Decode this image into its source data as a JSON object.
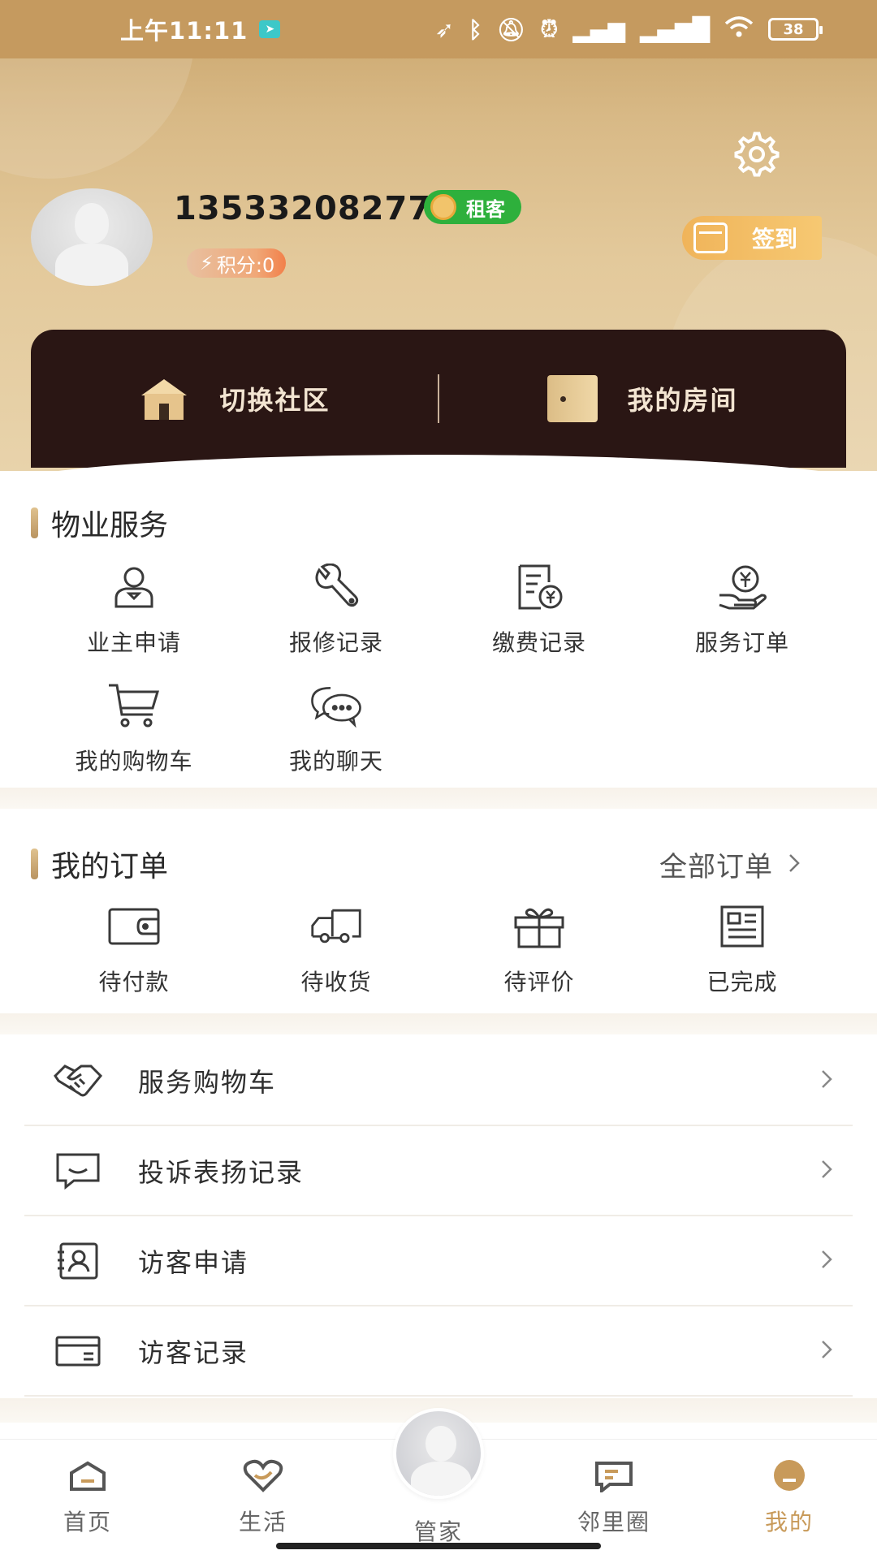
{
  "status_bar": {
    "time": "上午11:11",
    "battery": "38",
    "icons": [
      "location-icon",
      "bluetooth-icon",
      "mute-icon",
      "alarm-icon",
      "hd-signal-icon",
      "signal-icon",
      "wifi-icon",
      "battery-icon"
    ]
  },
  "profile": {
    "phone": "13533208277",
    "role": "租客",
    "points_label": "积分:0",
    "checkin_label": "签到"
  },
  "quick_actions": {
    "switch_community": "切换社区",
    "my_room": "我的房间"
  },
  "property_services": {
    "title": "物业服务",
    "items": [
      {
        "label": "业主申请",
        "icon": "owner-icon"
      },
      {
        "label": "报修记录",
        "icon": "wrench-icon"
      },
      {
        "label": "缴费记录",
        "icon": "bill-icon"
      },
      {
        "label": "服务订单",
        "icon": "service-order-icon"
      },
      {
        "label": "我的购物车",
        "icon": "cart-icon"
      },
      {
        "label": "我的聊天",
        "icon": "chat-icon"
      }
    ]
  },
  "my_orders": {
    "title": "我的订单",
    "all_orders": "全部订单",
    "items": [
      {
        "label": "待付款",
        "icon": "wallet-icon"
      },
      {
        "label": "待收货",
        "icon": "truck-icon"
      },
      {
        "label": "待评价",
        "icon": "gift-icon"
      },
      {
        "label": "已完成",
        "icon": "document-icon"
      }
    ]
  },
  "menu_list": [
    {
      "label": "服务购物车",
      "icon": "handshake-icon"
    },
    {
      "label": "投诉表扬记录",
      "icon": "message-icon"
    },
    {
      "label": "访客申请",
      "icon": "visitor-card-icon"
    },
    {
      "label": "访客记录",
      "icon": "card-icon"
    }
  ],
  "bottom_nav": [
    {
      "label": "首页",
      "icon": "home-icon"
    },
    {
      "label": "生活",
      "icon": "heart-icon"
    },
    {
      "label": "管家",
      "icon": "butler-avatar"
    },
    {
      "label": "邻里圈",
      "icon": "neighbor-icon"
    },
    {
      "label": "我的",
      "icon": "profile-icon"
    }
  ],
  "colors": {
    "header_gold": "#c9a46a",
    "dark_card": "#2a1614",
    "role_green": "#2eb03c",
    "accent_gold": "#c89a5a",
    "checkin_orange": "#f0b45a"
  }
}
